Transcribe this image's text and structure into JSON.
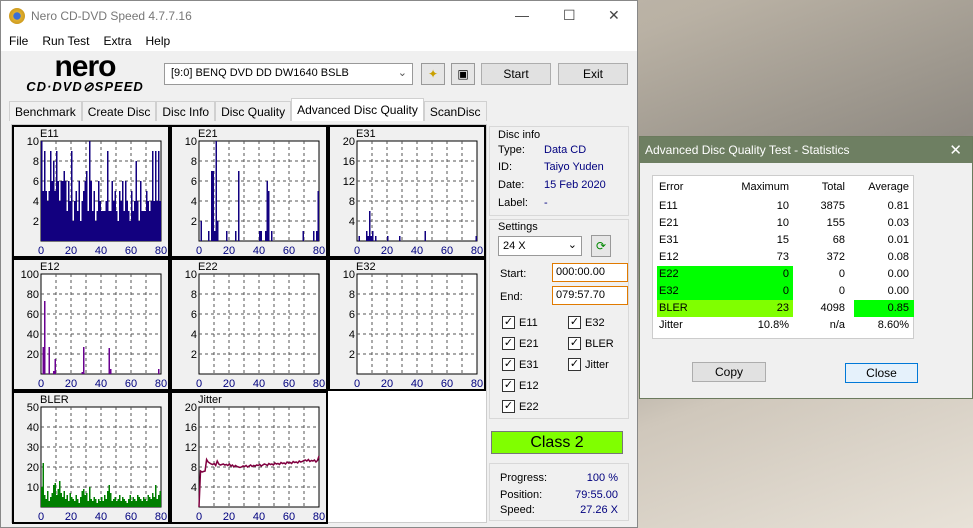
{
  "window": {
    "title": "Nero CD-DVD Speed 4.7.7.16",
    "minimize": "—",
    "maximize": "☐",
    "close": "✕"
  },
  "menu": [
    "File",
    "Run Test",
    "Extra",
    "Help"
  ],
  "logo": {
    "line1": "nero",
    "line2": "CD·DVD⊘SPEED"
  },
  "toolbar": {
    "drive": "[9:0]  BENQ DVD DD DW1640 BSLB",
    "start": "Start",
    "exit": "Exit",
    "icons": [
      "drive-config-icon",
      "save-icon"
    ]
  },
  "tabs": [
    "Benchmark",
    "Create Disc",
    "Disc Info",
    "Disc Quality",
    "Advanced Disc Quality",
    "ScanDisc"
  ],
  "active_tab": "Advanced Disc Quality",
  "disc_info": {
    "heading": "Disc info",
    "type_label": "Type:",
    "type": "Data CD",
    "id_label": "ID:",
    "id": "Taiyo Yuden",
    "date_label": "Date:",
    "date": "15 Feb 2020",
    "label_label": "Label:",
    "label": "-"
  },
  "settings": {
    "heading": "Settings",
    "speed": "24 X",
    "start_label": "Start:",
    "start": "000:00.00",
    "end_label": "End:",
    "end": "079:57.70",
    "checks": [
      {
        "label": "E11",
        "checked": true
      },
      {
        "label": "E32",
        "checked": true
      },
      {
        "label": "E21",
        "checked": true
      },
      {
        "label": "BLER",
        "checked": true
      },
      {
        "label": "E31",
        "checked": true
      },
      {
        "label": "Jitter",
        "checked": true
      },
      {
        "label": "E12",
        "checked": true
      },
      {
        "label": "E22",
        "checked": true
      }
    ]
  },
  "class": {
    "label": "Class 2",
    "color": "#80ff00"
  },
  "progress": {
    "progress_label": "Progress:",
    "progress": "100 %",
    "position_label": "Position:",
    "position": "79:55.00",
    "speed_label": "Speed:",
    "speed": "27.26 X"
  },
  "chart_data": [
    {
      "name": "E11",
      "type": "bar",
      "color": "#12007f",
      "ylim": [
        0,
        10
      ],
      "yticks": [
        2,
        4,
        6,
        8,
        10
      ],
      "xticks": [
        0,
        20,
        40,
        60,
        80
      ],
      "xlim": [
        0,
        80
      ],
      "values": [
        10,
        5,
        9,
        5,
        4,
        5,
        9,
        6,
        8,
        5,
        9,
        6,
        4,
        6,
        6,
        7,
        6,
        3,
        6,
        4,
        9,
        2,
        4,
        5,
        3,
        6,
        2,
        4,
        5,
        6,
        7,
        3,
        10,
        6,
        3,
        5,
        2,
        3,
        6,
        4,
        3,
        3,
        3,
        4,
        9,
        3,
        3,
        6,
        4,
        5,
        3,
        2,
        5,
        4,
        6,
        3,
        6,
        4,
        3,
        2,
        5,
        3,
        4,
        8,
        4,
        2,
        6,
        3,
        3,
        3,
        5,
        4,
        3,
        4,
        9,
        4,
        9,
        4,
        9,
        4
      ]
    },
    {
      "name": "E21",
      "type": "bar",
      "color": "#12007f",
      "ylim": [
        0,
        10
      ],
      "yticks": [
        2,
        4,
        6,
        8,
        10
      ],
      "xticks": [
        0,
        20,
        40,
        60,
        80
      ],
      "xlim": [
        0,
        80
      ],
      "values": [
        0,
        2,
        0,
        0,
        0,
        0,
        1,
        0,
        7,
        7,
        1,
        10,
        2,
        0,
        0,
        0,
        0,
        0,
        1,
        0,
        0,
        0,
        0,
        0,
        1,
        0,
        7,
        0,
        0,
        0,
        0,
        0,
        0,
        0,
        0,
        0,
        0,
        0,
        0,
        0,
        1,
        1,
        0,
        0,
        1,
        6,
        5,
        0,
        1,
        0,
        0,
        0,
        0,
        0,
        0,
        0,
        0,
        0,
        0,
        0,
        0,
        0,
        0,
        0,
        0,
        0,
        0,
        0,
        0,
        1,
        0,
        0,
        0,
        0,
        0,
        0,
        1,
        0,
        1,
        5
      ]
    },
    {
      "name": "E31",
      "type": "bar",
      "color": "#12007f",
      "ylim": [
        0,
        20
      ],
      "yticks": [
        4,
        8,
        12,
        16,
        20
      ],
      "xticks": [
        0,
        20,
        40,
        60,
        80
      ],
      "xlim": [
        0,
        80
      ],
      "values": [
        0,
        1,
        0,
        0,
        0,
        0,
        2,
        1,
        6,
        1,
        2,
        0,
        1,
        0,
        0,
        0,
        0,
        0,
        0,
        0,
        1,
        0,
        0,
        0,
        0,
        0,
        0,
        0,
        1,
        0,
        0,
        0,
        0,
        0,
        0,
        0,
        0,
        0,
        0,
        0,
        0,
        0,
        0,
        0,
        0,
        2,
        0,
        0,
        0,
        0,
        0,
        0,
        0,
        0,
        0,
        0,
        0,
        0,
        0,
        0,
        0,
        0,
        0,
        0,
        0,
        0,
        0,
        0,
        0,
        0,
        0,
        0,
        0,
        0,
        0,
        0,
        0,
        0,
        0,
        1
      ]
    },
    {
      "name": "E12",
      "type": "bar",
      "color": "#6a0090",
      "ylim": [
        0,
        100
      ],
      "yticks": [
        20,
        40,
        60,
        80,
        100
      ],
      "xticks": [
        0,
        20,
        40,
        60,
        80
      ],
      "xlim": [
        0,
        80
      ],
      "values": [
        0,
        27,
        73,
        0,
        0,
        27,
        0,
        0,
        3,
        15,
        0,
        0,
        0,
        0,
        0,
        0,
        0,
        0,
        0,
        0,
        0,
        0,
        0,
        0,
        0,
        0,
        0,
        2,
        27,
        0,
        0,
        0,
        0,
        0,
        0,
        0,
        0,
        0,
        0,
        0,
        0,
        0,
        0,
        0,
        0,
        26,
        5,
        0,
        0,
        0,
        0,
        0,
        0,
        0,
        0,
        0,
        0,
        0,
        0,
        0,
        0,
        0,
        0,
        0,
        0,
        0,
        0,
        0,
        0,
        0,
        0,
        0,
        0,
        0,
        0,
        0,
        0,
        0,
        5,
        0
      ]
    },
    {
      "name": "E22",
      "type": "bar",
      "color": "#12007f",
      "ylim": [
        0,
        10
      ],
      "yticks": [
        2,
        4,
        6,
        8,
        10
      ],
      "xticks": [
        0,
        20,
        40,
        60,
        80
      ],
      "xlim": [
        0,
        80
      ],
      "values": []
    },
    {
      "name": "E32",
      "type": "bar",
      "color": "#12007f",
      "ylim": [
        0,
        10
      ],
      "yticks": [
        2,
        4,
        6,
        8,
        10
      ],
      "xticks": [
        0,
        20,
        40,
        60,
        80
      ],
      "xlim": [
        0,
        80
      ],
      "values": []
    },
    {
      "name": "BLER",
      "type": "bar",
      "color": "#007f00",
      "ylim": [
        0,
        50
      ],
      "yticks": [
        10,
        20,
        30,
        40,
        50
      ],
      "xticks": [
        0,
        20,
        40,
        60,
        80
      ],
      "xlim": [
        0,
        80
      ],
      "values": [
        10,
        22,
        6,
        4,
        8,
        3,
        5,
        7,
        11,
        12,
        6,
        9,
        13,
        7,
        5,
        8,
        4,
        6,
        3,
        7,
        5,
        4,
        3,
        6,
        4,
        2,
        5,
        8,
        9,
        6,
        7,
        3,
        10,
        4,
        3,
        5,
        4,
        2,
        4,
        3,
        5,
        3,
        6,
        4,
        8,
        11,
        7,
        3,
        4,
        5,
        3,
        4,
        6,
        3,
        5,
        4,
        3,
        2,
        4,
        6,
        3,
        5,
        4,
        3,
        6,
        5,
        4,
        3,
        5,
        4,
        3,
        6,
        5,
        4,
        7,
        5,
        11,
        4,
        6,
        8
      ]
    },
    {
      "name": "Jitter",
      "type": "line",
      "color": "#800040",
      "ylim": [
        0,
        20
      ],
      "yticks": [
        4,
        8,
        12,
        16,
        20
      ],
      "xticks": [
        0,
        20,
        40,
        60,
        80
      ],
      "xlim": [
        0,
        80
      ],
      "values": [
        0,
        7.2,
        7.0,
        7.1,
        7.2,
        9.5,
        9.0,
        8.8,
        8.6,
        8.5,
        8.7,
        8.3,
        9.2,
        8.6,
        8.4,
        8.5,
        8.6,
        8.4,
        8.5,
        8.3,
        8.6,
        8.2,
        8.4,
        8.0,
        8.3,
        8.1,
        8.0,
        7.9,
        8.0,
        8.2,
        8.1,
        8.3,
        8.0,
        8.2,
        8.4,
        8.1,
        8.3,
        8.2,
        8.4,
        8.3,
        8.5,
        8.2,
        8.4,
        8.6,
        8.5,
        8.3,
        8.7,
        8.5,
        8.6,
        8.4,
        8.8,
        8.6,
        8.7,
        8.5,
        8.9,
        8.7,
        8.8,
        8.6,
        9.0,
        8.8,
        8.9,
        8.7,
        9.1,
        8.9,
        9.0,
        8.8,
        9.2,
        9.0,
        9.1,
        9.3,
        9.4,
        9.2,
        9.5,
        9.1,
        9.3,
        9.2,
        9.4,
        9.0,
        9.3,
        10.2
      ]
    }
  ],
  "stats": {
    "title": "Advanced Disc Quality Test - Statistics",
    "close_x": "✕",
    "headers": [
      "Error",
      "Maximum",
      "Total",
      "Average"
    ],
    "rows": [
      [
        "E11",
        "10",
        "3875",
        "0.81"
      ],
      [
        "E21",
        "10",
        "155",
        "0.03"
      ],
      [
        "E31",
        "15",
        "68",
        "0.01"
      ],
      [
        "E12",
        "73",
        "372",
        "0.08"
      ],
      [
        "E22",
        "0",
        "0",
        "0.00"
      ],
      [
        "E32",
        "0",
        "0",
        "0.00"
      ],
      [
        "BLER",
        "23",
        "4098",
        "0.85"
      ],
      [
        "Jitter",
        "10.8%",
        "n/a",
        "8.60%"
      ]
    ],
    "highlight_green": "#00ff00",
    "highlight_lime": "#80ff00",
    "copy": "Copy",
    "close": "Close"
  }
}
